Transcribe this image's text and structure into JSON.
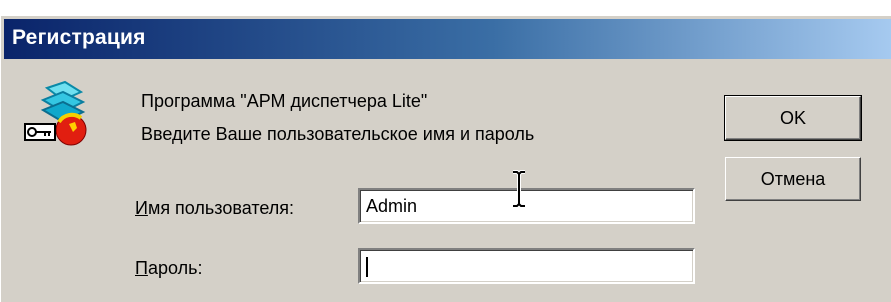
{
  "window": {
    "title": "Регистрация"
  },
  "message": {
    "line1": "Программа \"АРМ диспетчера Lite\"",
    "line2": "Введите Ваше пользовательское имя и пароль"
  },
  "form": {
    "username": {
      "label_mnemonic": "И",
      "label_rest": "мя пользователя:",
      "value": "Admin"
    },
    "password": {
      "label_mnemonic": "П",
      "label_rest": "ароль:",
      "value": ""
    }
  },
  "buttons": {
    "ok_label": "OK",
    "cancel_label": "Отмена"
  },
  "icons": {
    "app": "app-key-icon",
    "cursor": "i-beam-cursor-icon"
  },
  "colors": {
    "title_bar_start": "#0a246a",
    "title_bar_end": "#a6caf0",
    "dialog_background": "#d4d0c8",
    "field_background": "#ffffff"
  }
}
